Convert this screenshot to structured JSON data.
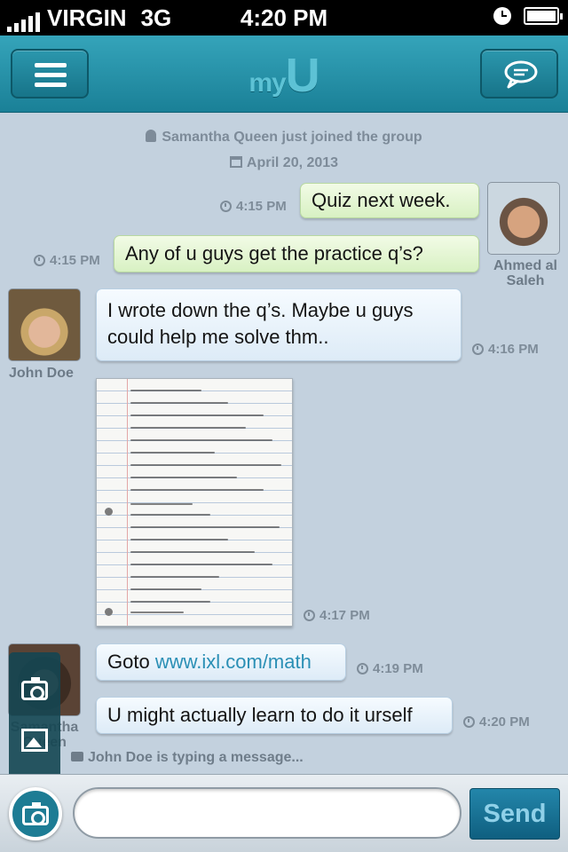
{
  "status_bar": {
    "carrier": "VIRGIN",
    "network": "3G",
    "time": "4:20 PM"
  },
  "navbar": {
    "logo_small": "my",
    "logo_big": "U",
    "menu_icon": "hamburger-menu-icon",
    "chat_icon": "speech-bubble-icon"
  },
  "system": {
    "joined": "Samantha Queen just joined the group",
    "date": "April 20, 2013",
    "typing": "John Doe is typing a message..."
  },
  "messages": [
    {
      "text": "Quiz next week.",
      "time": "4:15 PM"
    },
    {
      "text": "Any of u guys get the practice q’s?",
      "time": "4:15 PM"
    },
    {
      "text": "I wrote down the q’s. Maybe u guys could help me solve thm..",
      "time": "4:16 PM"
    },
    {
      "text": "",
      "time": "4:17 PM"
    },
    {
      "text_prefix": "Goto ",
      "link": "www.ixl.com/math",
      "time": "4:19 PM"
    },
    {
      "text": "U might actually learn to do it urself",
      "time": "4:20 PM"
    }
  ],
  "users": {
    "ahmed": "Ahmed al Saleh",
    "john": "John Doe",
    "samantha": "Samantha Queen"
  },
  "composer": {
    "input_value": "",
    "send_label": "Send"
  },
  "colors": {
    "background": "#c3d1de",
    "navbar": "#1a8097",
    "link": "#2a8fb5",
    "send": "#0f5f80"
  }
}
